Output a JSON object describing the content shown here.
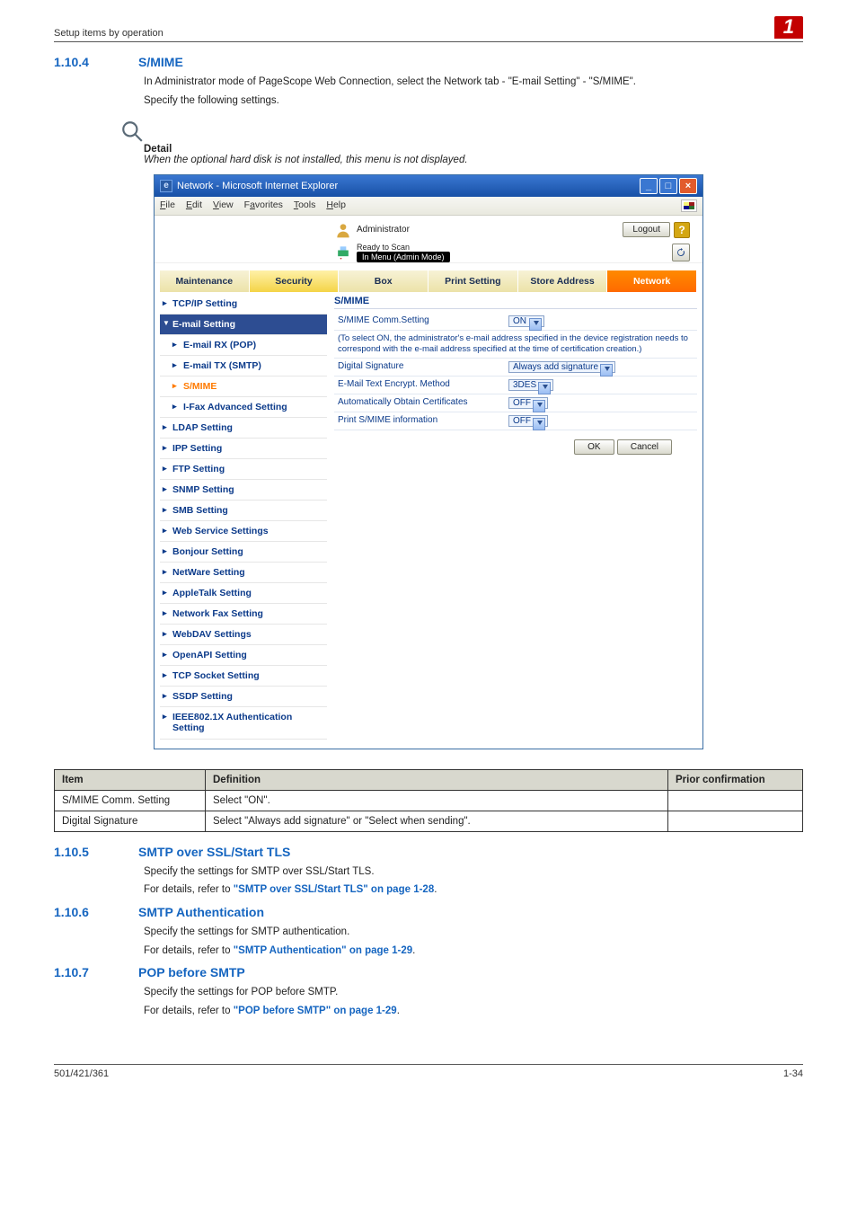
{
  "header": {
    "left": "Setup items by operation",
    "badge": "1"
  },
  "sec_1_10_4": {
    "num": "1.10.4",
    "title": "S/MIME",
    "p1": "In Administrator mode of PageScope Web Connection, select the Network tab - \"E-mail Setting\" - \"S/MIME\".",
    "p2": "Specify the following settings."
  },
  "detail": {
    "label": "Detail",
    "text": "When the optional hard disk is not installed, this menu is not displayed."
  },
  "ie": {
    "title": "Network - Microsoft Internet Explorer",
    "menu": {
      "file": "File",
      "edit": "Edit",
      "view": "View",
      "favorites": "Favorites",
      "tools": "Tools",
      "help": "Help"
    },
    "admin_label": "Administrator",
    "status_label": "Ready to Scan",
    "mode_label": "In Menu (Admin Mode)",
    "logout": "Logout",
    "help": "?",
    "tabs": [
      "Maintenance",
      "Security",
      "Box",
      "Print Setting",
      "Store Address",
      "Network"
    ],
    "sidebar": [
      {
        "label": "TCP/IP Setting",
        "type": "top"
      },
      {
        "label": "E-mail Setting",
        "type": "dark"
      },
      {
        "label": "E-mail RX (POP)",
        "type": "sub"
      },
      {
        "label": "E-mail TX (SMTP)",
        "type": "sub"
      },
      {
        "label": "S/MIME",
        "type": "sub-orange"
      },
      {
        "label": "I-Fax Advanced Setting",
        "type": "sub"
      },
      {
        "label": "LDAP Setting",
        "type": "top"
      },
      {
        "label": "IPP Setting",
        "type": "top"
      },
      {
        "label": "FTP Setting",
        "type": "top"
      },
      {
        "label": "SNMP Setting",
        "type": "top"
      },
      {
        "label": "SMB Setting",
        "type": "top"
      },
      {
        "label": "Web Service Settings",
        "type": "top"
      },
      {
        "label": "Bonjour Setting",
        "type": "top"
      },
      {
        "label": "NetWare Setting",
        "type": "top"
      },
      {
        "label": "AppleTalk Setting",
        "type": "top"
      },
      {
        "label": "Network Fax Setting",
        "type": "top"
      },
      {
        "label": "WebDAV Settings",
        "type": "top"
      },
      {
        "label": "OpenAPI Setting",
        "type": "top"
      },
      {
        "label": "TCP Socket Setting",
        "type": "top"
      },
      {
        "label": "SSDP Setting",
        "type": "top"
      },
      {
        "label": "IEEE802.1X Authentication Setting",
        "type": "top-multi"
      }
    ],
    "panel": {
      "title": "S/MIME",
      "rows": [
        {
          "label": "S/MIME Comm.Setting",
          "value": "ON",
          "note": "(To select ON, the administrator's e-mail address specified in the device registration needs to correspond with the e-mail address specified at the time of certification creation.)"
        },
        {
          "label": "Digital Signature",
          "value": "Always add signature"
        },
        {
          "label": "E-Mail Text Encrypt. Method",
          "value": "3DES"
        },
        {
          "label": "Automatically Obtain Certificates",
          "value": "OFF"
        },
        {
          "label": "Print S/MIME information",
          "value": "OFF"
        }
      ],
      "ok": "OK",
      "cancel": "Cancel"
    }
  },
  "def_table": {
    "headers": [
      "Item",
      "Definition",
      "Prior confirmation"
    ],
    "rows": [
      [
        "S/MIME Comm. Setting",
        "Select \"ON\".",
        ""
      ],
      [
        "Digital Signature",
        "Select \"Always add signature\" or \"Select when sending\".",
        ""
      ]
    ]
  },
  "sec_1_10_5": {
    "num": "1.10.5",
    "title": "SMTP over SSL/Start TLS",
    "p1": "Specify the settings for SMTP over SSL/Start TLS.",
    "p2_a": "For details, refer to ",
    "p2_link": "\"SMTP over SSL/Start TLS\" on page 1-28",
    "p2_b": "."
  },
  "sec_1_10_6": {
    "num": "1.10.6",
    "title": "SMTP Authentication",
    "p1": "Specify the settings for SMTP authentication.",
    "p2_a": "For details, refer to ",
    "p2_link": "\"SMTP Authentication\" on page 1-29",
    "p2_b": "."
  },
  "sec_1_10_7": {
    "num": "1.10.7",
    "title": "POP before SMTP",
    "p1": "Specify the settings for POP before SMTP.",
    "p2_a": "For details, refer to ",
    "p2_link": "\"POP before SMTP\" on page 1-29",
    "p2_b": "."
  },
  "footer": {
    "left": "501/421/361",
    "right": "1-34"
  }
}
